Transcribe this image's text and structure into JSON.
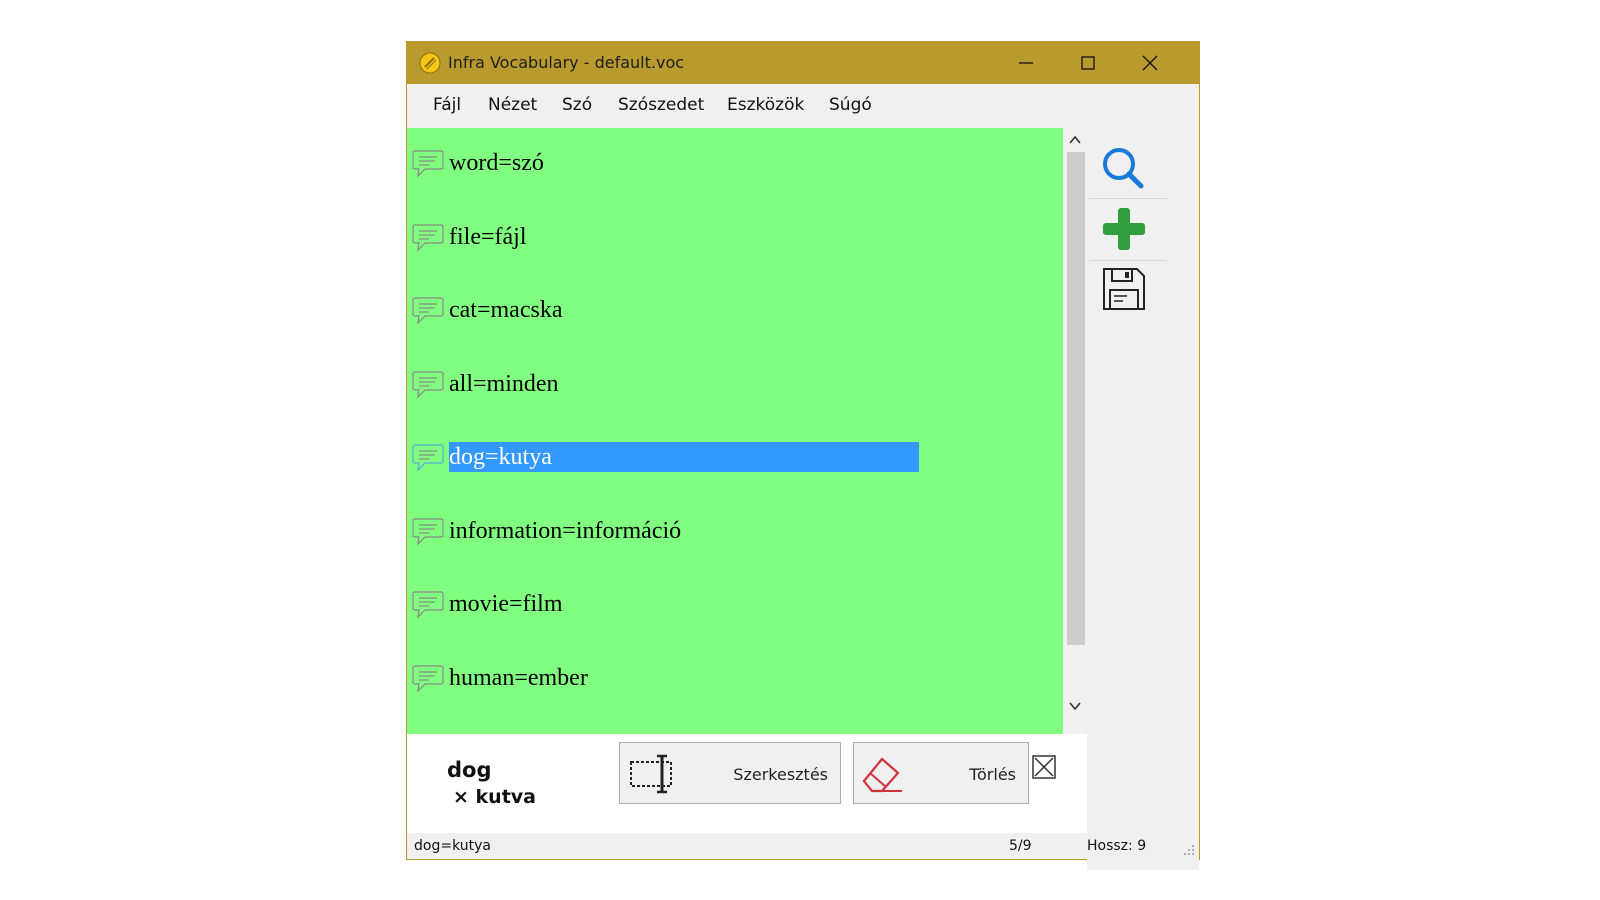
{
  "window": {
    "title": "Infra Vocabulary - default.voc",
    "title_bar_color": "#b89a2e"
  },
  "menu": [
    "Fájl",
    "Nézet",
    "Szó",
    "Szószedet",
    "Eszközök",
    "Súgó"
  ],
  "list": {
    "background_color": "#80ff80",
    "selection_color": "#3399ff",
    "items": [
      "word=szó",
      "file=fájl",
      "cat=macska",
      "all=minden",
      "dog=kutya",
      "information=információ",
      "movie=film",
      "human=ember"
    ],
    "selected_index": 4,
    "item_icon": "speech-bubble-icon"
  },
  "toolbar": {
    "tools": [
      "search-icon",
      "add-icon",
      "save-icon"
    ]
  },
  "detail": {
    "word": "dog",
    "translation": "× kutva",
    "edit_label": "Szerkesztés",
    "delete_label": "Törlés"
  },
  "status": {
    "entry": "dog=kutya",
    "position": "5/9",
    "length": "Hossz: 9"
  }
}
